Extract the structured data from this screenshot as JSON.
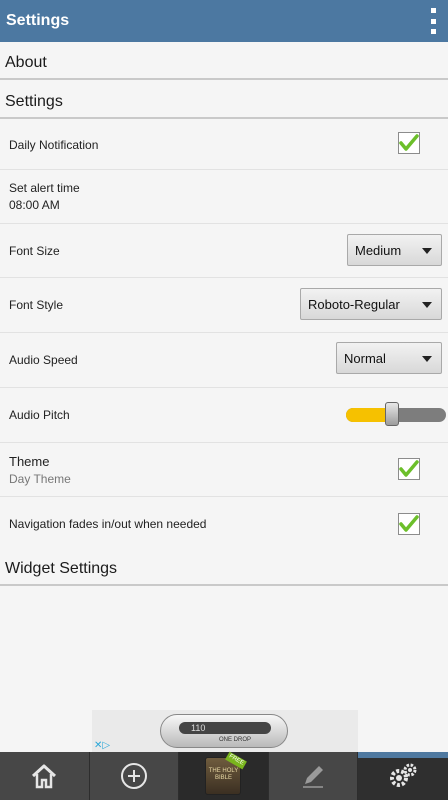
{
  "appbar": {
    "title": "Settings",
    "menu_icon": "overflow-menu-icon"
  },
  "sections": {
    "about": "About",
    "settings": "Settings",
    "widget": "Widget Settings"
  },
  "settings": {
    "daily_notification": {
      "label": "Daily Notification",
      "checked": true
    },
    "alert_time": {
      "label": "Set alert time",
      "value": "08:00 AM"
    },
    "font_size": {
      "label": "Font Size",
      "selected": "Medium"
    },
    "font_style": {
      "label": "Font Style",
      "selected": "Roboto-Regular"
    },
    "audio_speed": {
      "label": "Audio Speed",
      "selected": "Normal"
    },
    "audio_pitch": {
      "label": "Audio Pitch",
      "value": 0.46
    },
    "theme": {
      "label": "Theme",
      "value": "Day Theme",
      "checked": true
    },
    "navigation": {
      "label": "Navigation fades in/out when needed",
      "checked": true
    }
  },
  "ad": {
    "screen_text": "110",
    "brand_text": "ONE DROP"
  },
  "tabbar": {
    "tabs": [
      {
        "icon": "home-icon"
      },
      {
        "icon": "add-circle-icon"
      },
      {
        "icon": "holy-bible-icon",
        "book_text": "THE HOLY BIBLE",
        "badge": "FREE"
      },
      {
        "icon": "pencil-icon"
      },
      {
        "icon": "gears-icon"
      }
    ]
  },
  "colors": {
    "appbar": "#4c78a1",
    "checkmark": "#6cbf2a",
    "slider_fill": "#f6c100",
    "tabbar": "#474747"
  }
}
